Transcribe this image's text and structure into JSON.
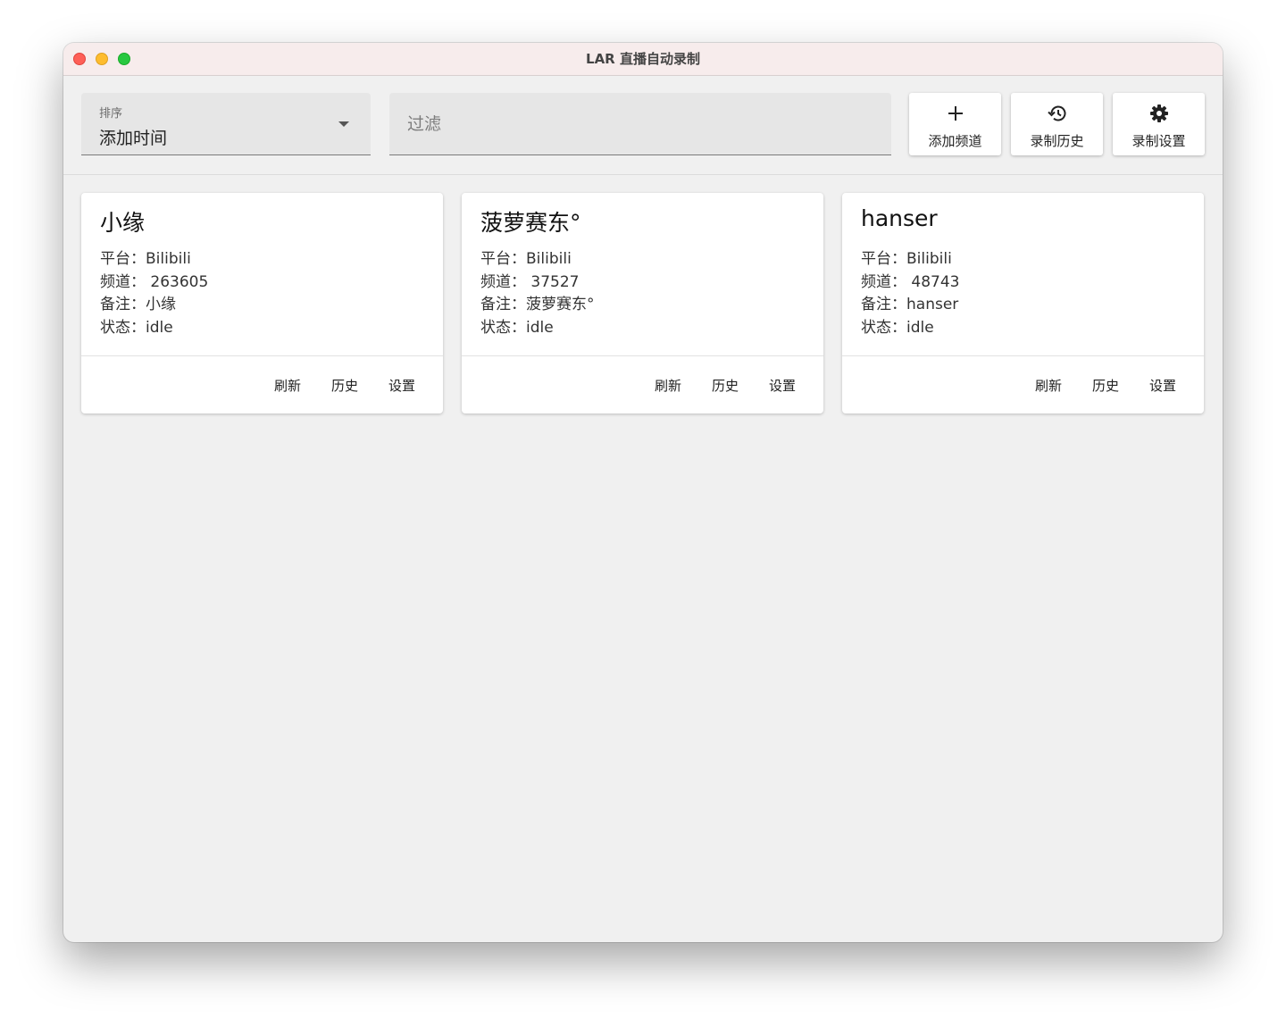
{
  "window": {
    "title": "LAR 直播自动录制"
  },
  "toolbar": {
    "sort": {
      "label": "排序",
      "value": "添加时间"
    },
    "filter": {
      "placeholder": "过滤",
      "value": ""
    },
    "buttons": [
      {
        "label": "添加频道",
        "icon": "plus-icon"
      },
      {
        "label": "录制历史",
        "icon": "history-icon"
      },
      {
        "label": "录制设置",
        "icon": "gear-icon"
      }
    ]
  },
  "field_labels": {
    "platform": "平台：",
    "channel": "频道：",
    "note": "备注：",
    "status": "状态："
  },
  "cards": [
    {
      "title": "小缘",
      "platform": "Bilibili",
      "channel": " 263605",
      "note": "小缘",
      "status": "idle",
      "actions": [
        "刷新",
        "历史",
        "设置"
      ]
    },
    {
      "title": "菠萝赛东°",
      "platform": "Bilibili",
      "channel": " 37527",
      "note": "菠萝赛东°",
      "status": "idle",
      "actions": [
        "刷新",
        "历史",
        "设置"
      ]
    },
    {
      "title": "hanser",
      "platform": "Bilibili",
      "channel": " 48743",
      "note": "hanser",
      "status": "idle",
      "actions": [
        "刷新",
        "历史",
        "设置"
      ]
    }
  ]
}
